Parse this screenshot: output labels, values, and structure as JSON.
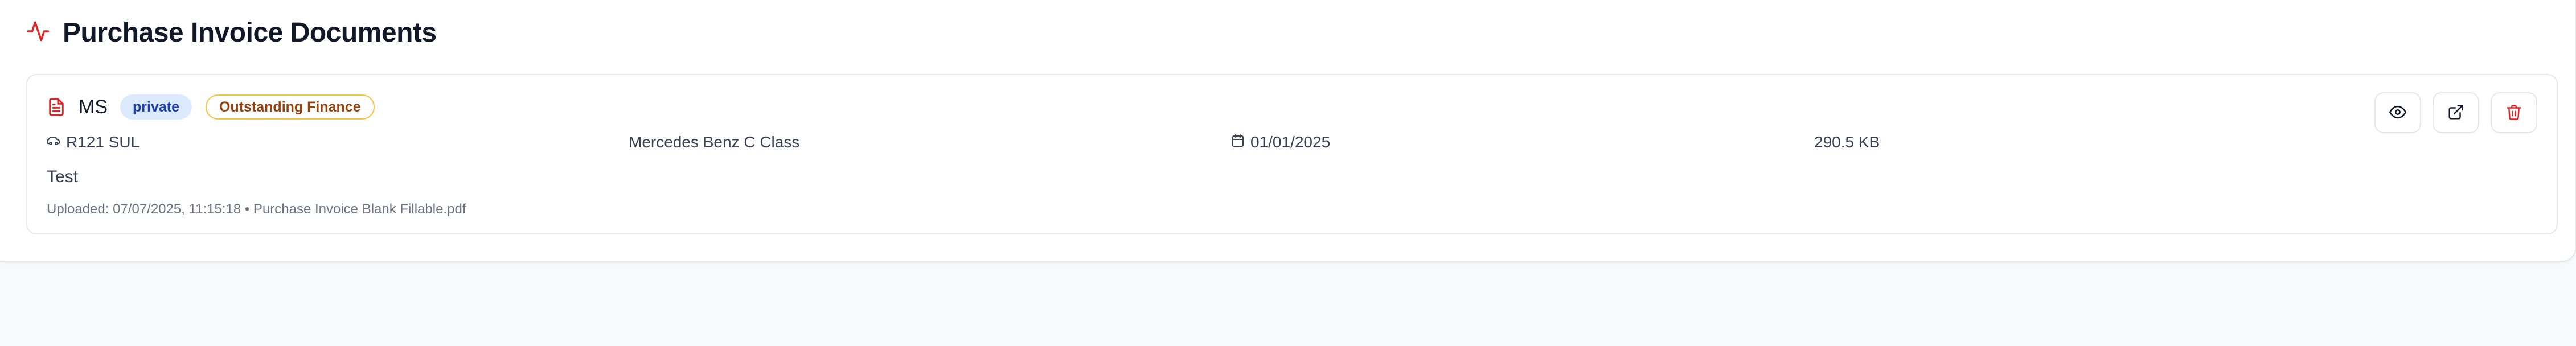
{
  "page": {
    "title": "Purchase Invoice Documents"
  },
  "document": {
    "initials": "MS",
    "visibility_badge": "private",
    "status_badge": "Outstanding Finance",
    "registration": "R121 SUL",
    "vehicle_model": "Mercedes Benz C Class",
    "date": "01/01/2025",
    "file_size": "290.5 KB",
    "notes": "Test",
    "uploaded_meta": "Uploaded: 07/07/2025, 11:15:18 • Purchase Invoice Blank Fillable.pdf"
  },
  "colors": {
    "accent_red": "#dc2626",
    "badge_private_bg": "#dbeafe",
    "badge_private_text": "#1e40af",
    "badge_status_border": "#f5c242",
    "badge_status_text": "#92400e"
  },
  "icons": {
    "header": "activity-icon",
    "document": "file-text-icon",
    "registration": "car-icon",
    "date": "calendar-icon",
    "view": "eye-icon",
    "open": "external-link-icon",
    "delete": "trash-icon"
  }
}
